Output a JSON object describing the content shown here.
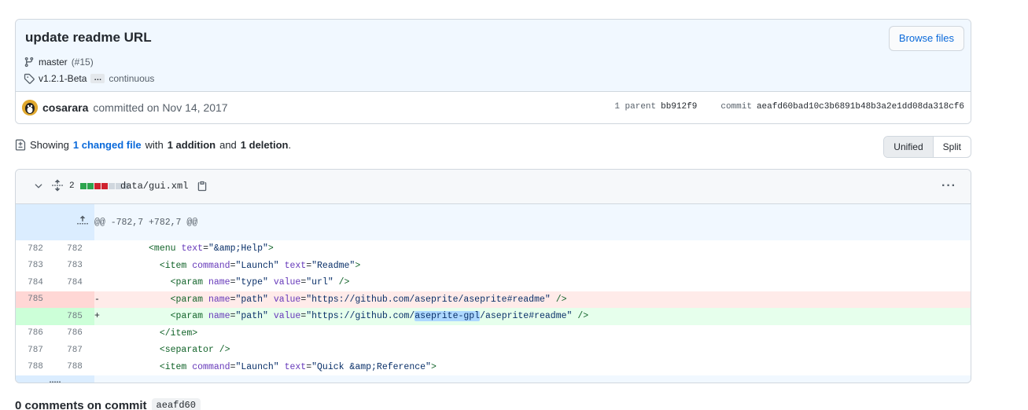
{
  "commit": {
    "title": "update readme URL",
    "browse_label": "Browse files",
    "branch": "master",
    "pr": "(#15)",
    "tag": "v1.2.1-Beta",
    "ellipsis": "…",
    "tag_more": "continuous",
    "author": "cosarara",
    "committed_on": "committed on Nov 14, 2017",
    "parent_label": "1 parent",
    "parent_sha": "bb912f9",
    "commit_label": "commit",
    "commit_sha": "aeafd60bad10c3b6891b48b3a2e1dd08da318cf6"
  },
  "summary": {
    "showing": "Showing",
    "changed": "1 changed file",
    "with": "with",
    "additions": "1 addition",
    "and": "and",
    "deletions": "1 deletion",
    "period": "."
  },
  "view_toggle": {
    "unified": "Unified",
    "split": "Split",
    "selected": "Unified"
  },
  "file": {
    "change_count": "2",
    "name": "data/gui.xml",
    "hunk_header": "@@ -782,7 +782,7 @@"
  },
  "diff_lines": [
    {
      "type": "ctx",
      "old": "782",
      "new": "782",
      "marker": " ",
      "indent": "        ",
      "tag": "menu",
      "attrs": [
        [
          "text",
          "\"&amp;Help\""
        ]
      ],
      "close": ">"
    },
    {
      "type": "ctx",
      "old": "783",
      "new": "783",
      "marker": " ",
      "indent": "          ",
      "tag": "item",
      "attrs": [
        [
          "command",
          "\"Launch\""
        ],
        [
          "text",
          "\"Readme\""
        ]
      ],
      "close": ">"
    },
    {
      "type": "ctx",
      "old": "784",
      "new": "784",
      "marker": " ",
      "indent": "            ",
      "tag": "param",
      "attrs": [
        [
          "name",
          "\"type\""
        ],
        [
          "value",
          "\"url\""
        ]
      ],
      "close": " />"
    },
    {
      "type": "del",
      "old": "785",
      "new": "",
      "marker": "-",
      "indent": "            ",
      "tag": "param",
      "attrs": [
        [
          "name",
          "\"path\""
        ],
        [
          "value",
          "\"https://github.com/aseprite/aseprite#readme\""
        ]
      ],
      "close": " />"
    },
    {
      "type": "add",
      "old": "",
      "new": "785",
      "marker": "+",
      "indent": "            ",
      "tag": "param",
      "attrs": [
        [
          "name",
          "\"path\""
        ],
        [
          "value",
          "\"https://github.com/aseprite-gpl/aseprite#readme\""
        ]
      ],
      "close": " />",
      "highlight": "aseprite-gpl"
    },
    {
      "type": "ctx",
      "old": "786",
      "new": "786",
      "marker": " ",
      "indent": "          ",
      "raw": "</item>"
    },
    {
      "type": "ctx",
      "old": "787",
      "new": "787",
      "marker": " ",
      "indent": "          ",
      "tag": "separator",
      "attrs": [],
      "close": " />"
    },
    {
      "type": "ctx",
      "old": "788",
      "new": "788",
      "marker": " ",
      "indent": "          ",
      "tag": "item",
      "attrs": [
        [
          "command",
          "\"Launch\""
        ],
        [
          "text",
          "\"Quick &amp;Reference\""
        ]
      ],
      "close": ">"
    }
  ],
  "comments": {
    "label": "0 comments on commit",
    "sha": "aeafd60"
  },
  "colors": {
    "accent": "#0969da",
    "add_bg": "#e6ffec",
    "del_bg": "#ffebe9",
    "diffstat": [
      "#2da44e",
      "#2da44e",
      "#cf222e",
      "#cf222e",
      "#d0d7de",
      "#d0d7de",
      "#d0d7de"
    ]
  },
  "icons": {
    "branch": "git-branch-icon",
    "tag": "tag-icon",
    "file_diff": "file-diff-icon",
    "chevron": "chevron-down-icon",
    "expand": "unfold-icon",
    "copy": "copy-icon",
    "kebab": "kebab-horizontal-icon",
    "expand_up": "fold-up-icon",
    "expand_down": "fold-down-icon"
  }
}
